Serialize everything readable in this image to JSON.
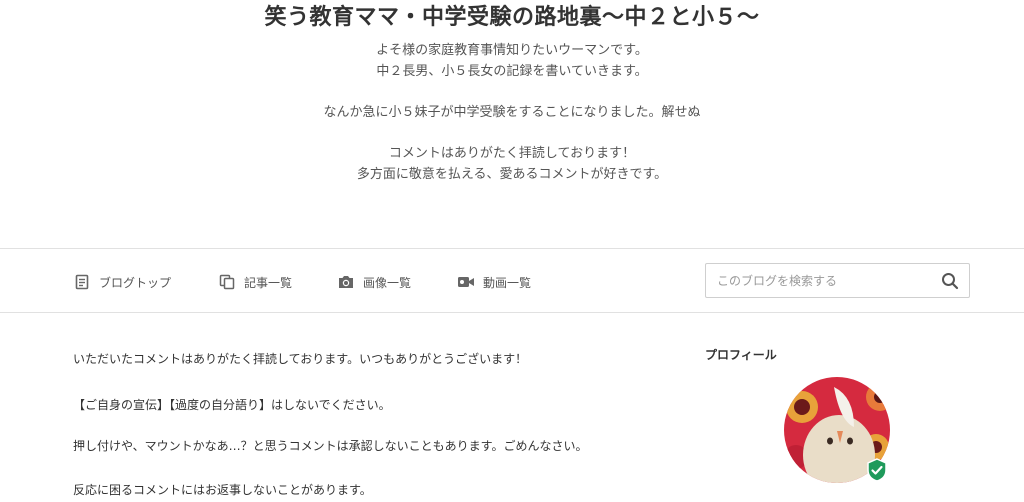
{
  "header": {
    "title": "笑う教育ママ・中学受験の路地裏〜中２と小５〜",
    "description": [
      "よそ様の家庭教育事情知りたいウーマンです。",
      "中２長男、小５長女の記録を書いていきます。",
      "",
      "なんか急に小５妹子が中学受験をすることになりました。解せぬ",
      "",
      "コメントはありがたく拝読しております！",
      "多方面に敬意を払える、愛あるコメントが好きです。"
    ]
  },
  "nav": {
    "blog_top": "ブログトップ",
    "articles": "記事一覧",
    "images": "画像一覧",
    "videos": "動画一覧",
    "icons": {
      "blog_top": "document-icon",
      "articles": "copy-icon",
      "images": "camera-icon",
      "videos": "video-icon"
    }
  },
  "search": {
    "placeholder": "このブログを検索する",
    "value": ""
  },
  "main": {
    "lines": [
      "いただいたコメントはありがたく拝読しております。いつもありがとうございます！",
      "【ご自身の宣伝】【過度の自分語り】はしないでください。",
      "押し付けや、マウントかなあ…？と思うコメントは承認しないこともあります。ごめんなさい。",
      "反応に困るコメントにはお返事しないことがあります。"
    ]
  },
  "sidebar": {
    "profile_heading": "プロフィール"
  },
  "colors": {
    "text": "#333333",
    "subtext": "#555555",
    "border": "#e1e1e1",
    "verified": "#1f9a5b",
    "avatar_bg": "#d52a3f"
  }
}
